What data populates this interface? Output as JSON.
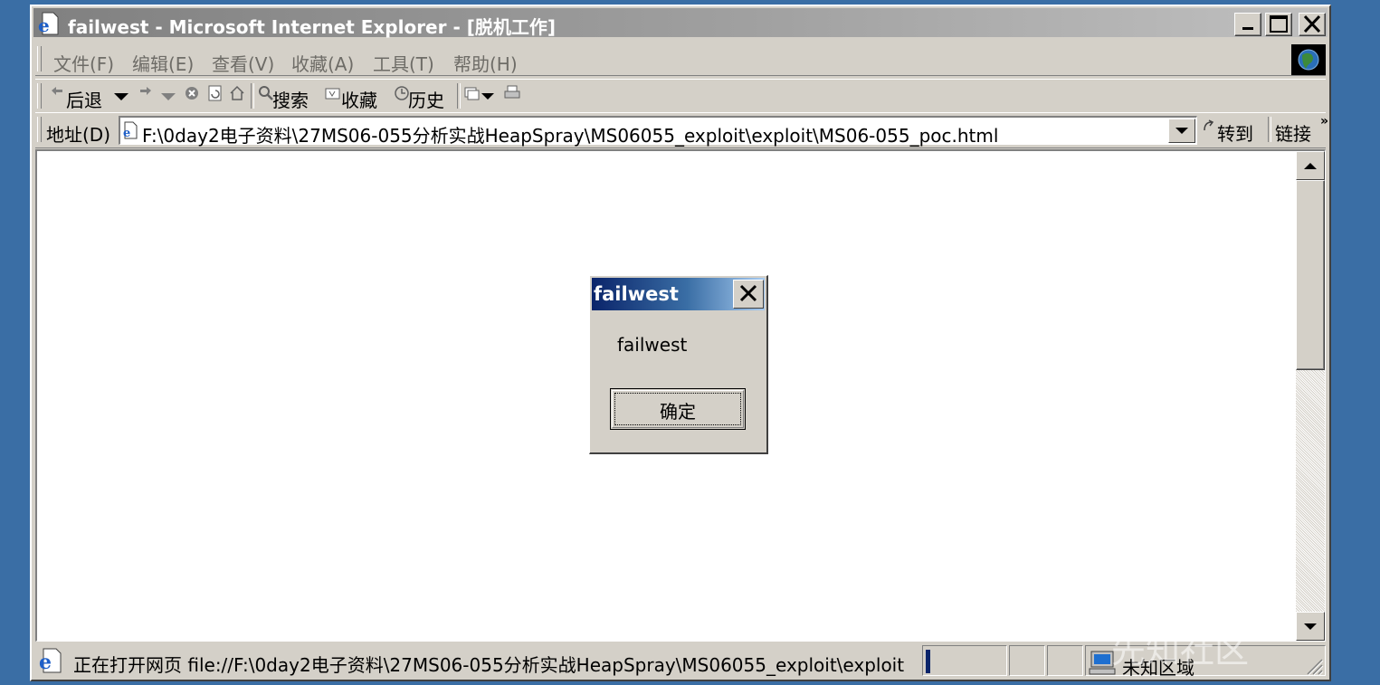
{
  "window": {
    "title": "failwest - Microsoft Internet Explorer - [脱机工作]"
  },
  "menubar": {
    "items": [
      {
        "label": "文件(F)"
      },
      {
        "label": "编辑(E)"
      },
      {
        "label": "查看(V)"
      },
      {
        "label": "收藏(A)"
      },
      {
        "label": "工具(T)"
      },
      {
        "label": "帮助(H)"
      }
    ]
  },
  "toolbar": {
    "back_label": "后退",
    "search_label": "搜索",
    "favorites_label": "收藏",
    "history_label": "历史"
  },
  "addressbar": {
    "label": "地址(D)",
    "url": "F:\\0day2电子资料\\27MS06-055分析实战HeapSpray\\MS06055_exploit\\exploit\\MS06-055_poc.html",
    "go_label": "转到",
    "links_label": "链接"
  },
  "dialog": {
    "title": "failwest",
    "message": "failwest",
    "ok_label": "确定"
  },
  "statusbar": {
    "text": "正在打开网页 file://F:\\0day2电子资料\\27MS06-055分析实战HeapSpray\\MS06055_exploit\\exploit",
    "zone": "未知区域"
  },
  "watermark": "先知社区",
  "colors": {
    "desktop": "#3a6ea5",
    "chrome": "#d4d0c8",
    "dialog_title_start": "#0a246a",
    "dialog_title_end": "#a6caf0"
  }
}
